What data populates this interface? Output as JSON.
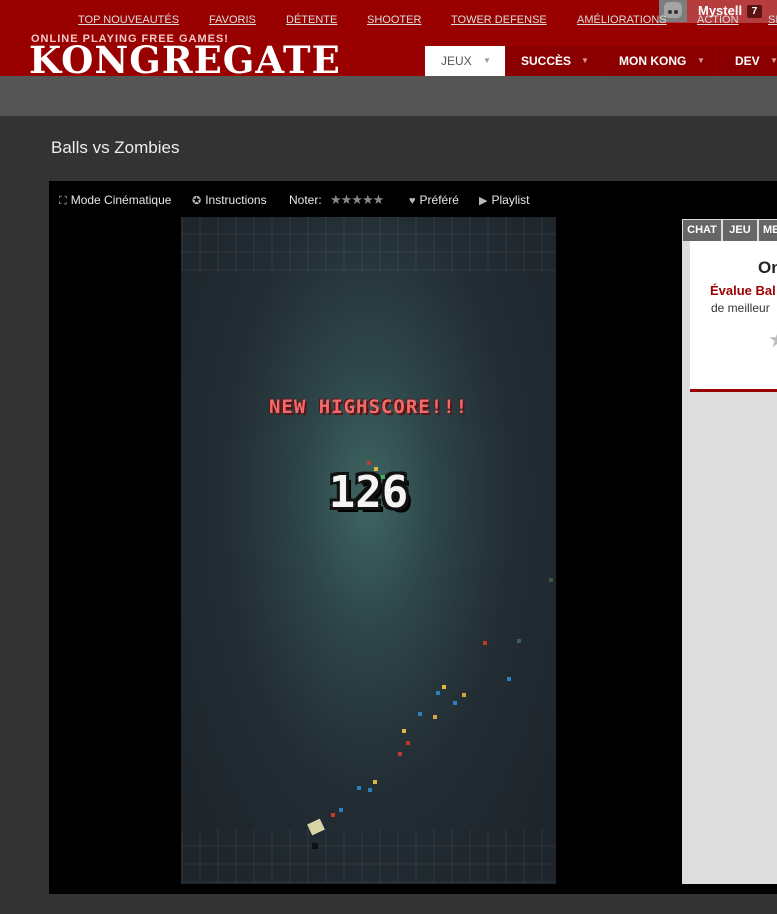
{
  "header": {
    "tagline": "ONLINE PLAYING FREE GAMES!",
    "logo": "KONGREGATE",
    "user": {
      "name": "Mystell",
      "badge": "7"
    },
    "tabs": [
      {
        "label": "JEUX",
        "arrow": "▼"
      },
      {
        "label": "SUCCÈS",
        "arrow": "▼"
      },
      {
        "label": "MON KONG",
        "arrow": "▼"
      },
      {
        "label": "DEV",
        "arrow": "▼"
      }
    ]
  },
  "subnav": {
    "items": [
      "TOP NOUVEAUTÉS",
      "FAVORIS",
      "DÉTENTE",
      "SHOOTER",
      "TOWER DEFENSE",
      "AMÉLIORATIONS",
      "ACTION",
      "SI"
    ]
  },
  "game": {
    "title": "Balls vs Zombies",
    "toolbar": {
      "cinema": "Mode Cinématique",
      "instructions": "Instructions",
      "rate": "Noter:",
      "stars": "★★★★★",
      "favorite": "Préféré",
      "playlist": "Playlist"
    },
    "banner": "NEW HIGHSCORE!!!",
    "score": "126"
  },
  "panel": {
    "tabs": [
      "CHAT",
      "JEU",
      "ME"
    ],
    "heading": "On",
    "rate_text": "Évalue Bal",
    "best_text": "de meilleur",
    "star": "★"
  },
  "colors": {
    "brand_red": "#990000",
    "subnav_bg": "#555555",
    "page_bg": "#333333",
    "highscore_red": "#f06c6c"
  }
}
